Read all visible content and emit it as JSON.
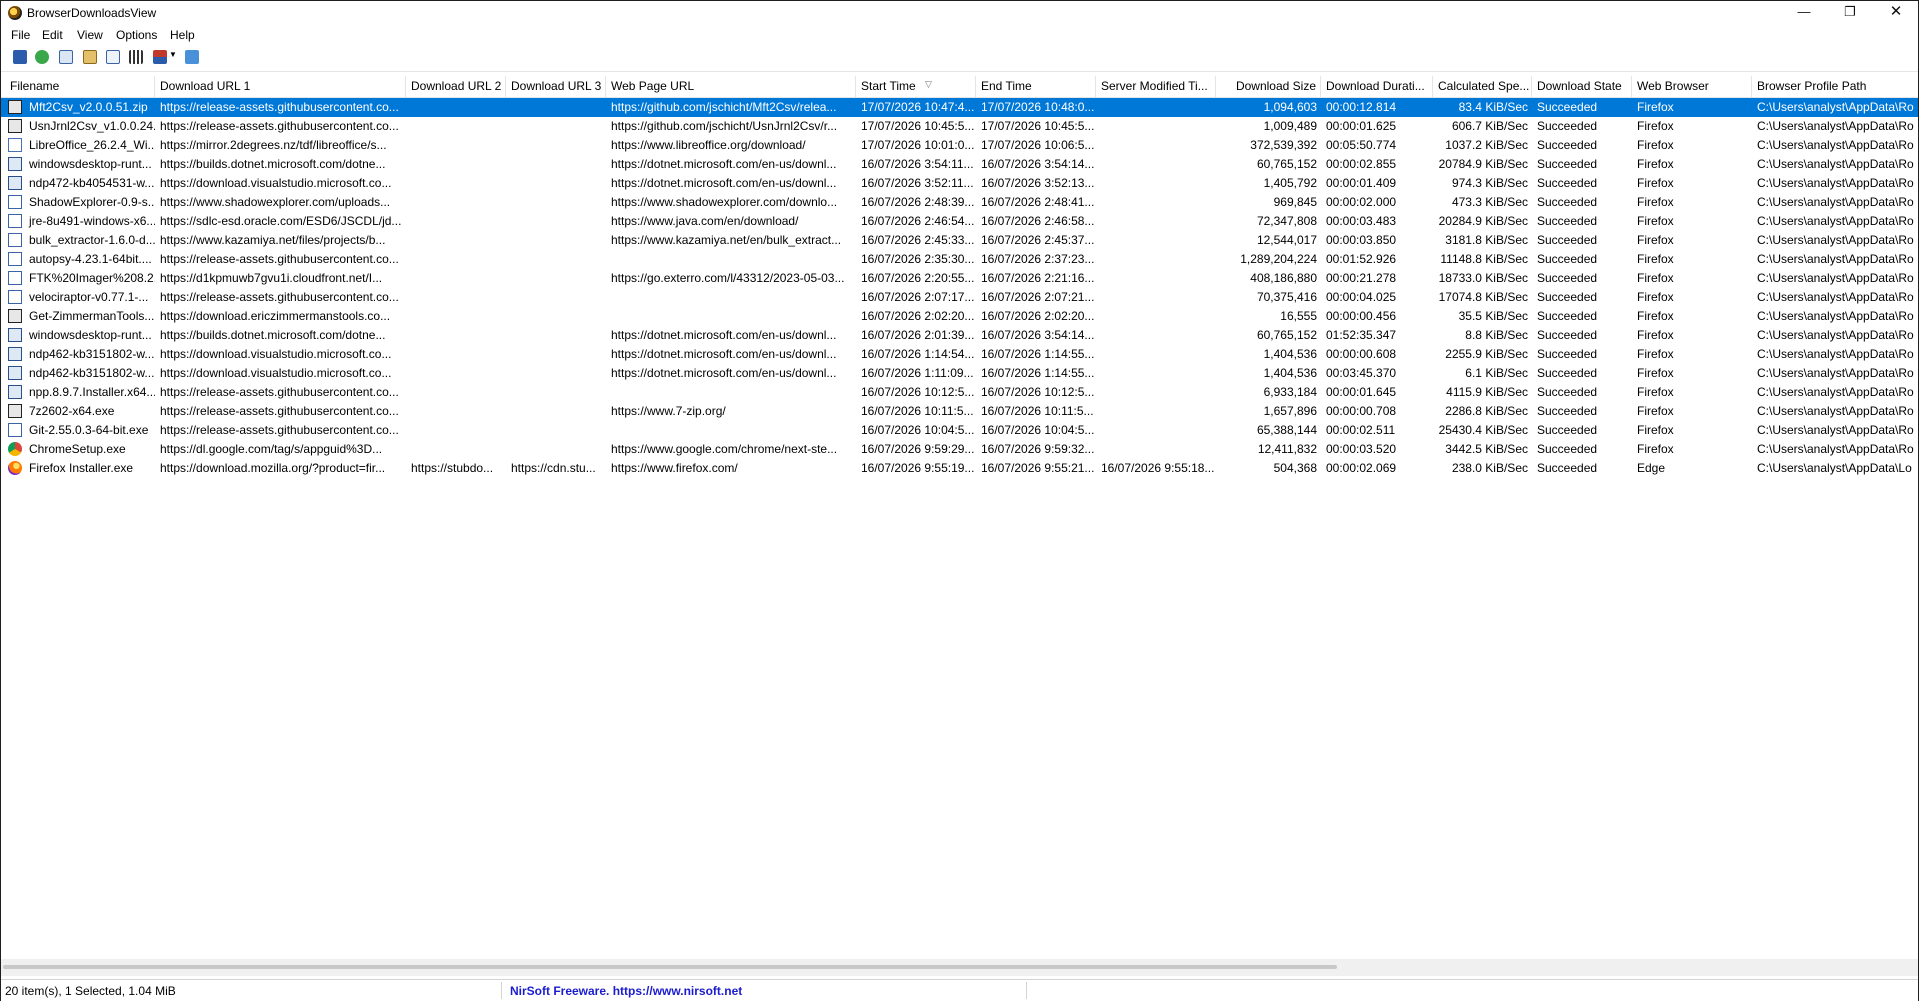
{
  "window": {
    "title": "BrowserDownloadsView",
    "minimize": "—",
    "maximize": "❐",
    "close": "✕"
  },
  "menu": [
    "File",
    "Edit",
    "View",
    "Options",
    "Help"
  ],
  "toolbar": [
    "save-icon",
    "refresh-icon",
    "copy-icon",
    "properties-icon",
    "find-icon",
    "html-report-icon",
    "sort-icon",
    "exit-icon"
  ],
  "columns": [
    "Filename",
    "Download URL 1",
    "Download URL 2",
    "Download URL 3",
    "Web Page URL",
    "Start Time",
    "End Time",
    "Server Modified Ti...",
    "Download Size",
    "Download Durati...",
    "Calculated Spe...",
    "Download State",
    "Web Browser",
    "Browser Profile Path"
  ],
  "rows": [
    {
      "icon": "zip",
      "selected": true,
      "c": [
        "Mft2Csv_v2.0.0.51.zip",
        "https://release-assets.githubusercontent.co...",
        "",
        "",
        "https://github.com/jschicht/Mft2Csv/relea...",
        "17/07/2026 10:47:4...",
        "17/07/2026 10:48:0...",
        "",
        "1,094,603",
        "00:00:12.814",
        "83.4 KiB/Sec",
        "Succeeded",
        "Firefox",
        "C:\\Users\\analyst\\AppData\\Ro"
      ]
    },
    {
      "icon": "zip",
      "c": [
        "UsnJrnl2Csv_v1.0.0.24....",
        "https://release-assets.githubusercontent.co...",
        "",
        "",
        "https://github.com/jschicht/UsnJrnl2Csv/r...",
        "17/07/2026 10:45:5...",
        "17/07/2026 10:45:5...",
        "",
        "1,009,489",
        "00:00:01.625",
        "606.7 KiB/Sec",
        "Succeeded",
        "Firefox",
        "C:\\Users\\analyst\\AppData\\Ro"
      ]
    },
    {
      "icon": "msi",
      "c": [
        "LibreOffice_26.2.4_Wi...",
        "https://mirror.2degrees.nz/tdf/libreoffice/s...",
        "",
        "",
        "https://www.libreoffice.org/download/",
        "17/07/2026 10:01:0...",
        "17/07/2026 10:06:5...",
        "",
        "372,539,392",
        "00:05:50.774",
        "1037.2 KiB/Sec",
        "Succeeded",
        "Firefox",
        "C:\\Users\\analyst\\AppData\\Ro"
      ]
    },
    {
      "icon": "setup",
      "c": [
        "windowsdesktop-runt...",
        "https://builds.dotnet.microsoft.com/dotne...",
        "",
        "",
        "https://dotnet.microsoft.com/en-us/downl...",
        "16/07/2026 3:54:11...",
        "16/07/2026 3:54:14...",
        "",
        "60,765,152",
        "00:00:02.855",
        "20784.9 KiB/Sec",
        "Succeeded",
        "Firefox",
        "C:\\Users\\analyst\\AppData\\Ro"
      ]
    },
    {
      "icon": "setup",
      "c": [
        "ndp472-kb4054531-w...",
        "https://download.visualstudio.microsoft.co...",
        "",
        "",
        "https://dotnet.microsoft.com/en-us/downl...",
        "16/07/2026 3:52:11...",
        "16/07/2026 3:52:13...",
        "",
        "1,405,792",
        "00:00:01.409",
        "974.3 KiB/Sec",
        "Succeeded",
        "Firefox",
        "C:\\Users\\analyst\\AppData\\Ro"
      ]
    },
    {
      "icon": "exe",
      "c": [
        "ShadowExplorer-0.9-s...",
        "https://www.shadowexplorer.com/uploads...",
        "",
        "",
        "https://www.shadowexplorer.com/downlo...",
        "16/07/2026 2:48:39...",
        "16/07/2026 2:48:41...",
        "",
        "969,845",
        "00:00:02.000",
        "473.3 KiB/Sec",
        "Succeeded",
        "Firefox",
        "C:\\Users\\analyst\\AppData\\Ro"
      ]
    },
    {
      "icon": "exe",
      "c": [
        "jre-8u491-windows-x6...",
        "https://sdlc-esd.oracle.com/ESD6/JSCDL/jd...",
        "",
        "",
        "https://www.java.com/en/download/",
        "16/07/2026 2:46:54...",
        "16/07/2026 2:46:58...",
        "",
        "72,347,808",
        "00:00:03.483",
        "20284.9 KiB/Sec",
        "Succeeded",
        "Firefox",
        "C:\\Users\\analyst\\AppData\\Ro"
      ]
    },
    {
      "icon": "exe",
      "c": [
        "bulk_extractor-1.6.0-d...",
        "https://www.kazamiya.net/files/projects/b...",
        "",
        "",
        "https://www.kazamiya.net/en/bulk_extract...",
        "16/07/2026 2:45:33...",
        "16/07/2026 2:45:37...",
        "",
        "12,544,017",
        "00:00:03.850",
        "3181.8 KiB/Sec",
        "Succeeded",
        "Firefox",
        "C:\\Users\\analyst\\AppData\\Ro"
      ]
    },
    {
      "icon": "exe",
      "c": [
        "autopsy-4.23.1-64bit....",
        "https://release-assets.githubusercontent.co...",
        "",
        "",
        "",
        "16/07/2026 2:35:30...",
        "16/07/2026 2:37:23...",
        "",
        "1,289,204,224",
        "00:01:52.926",
        "11148.8 KiB/Sec",
        "Succeeded",
        "Firefox",
        "C:\\Users\\analyst\\AppData\\Ro"
      ]
    },
    {
      "icon": "exe",
      "c": [
        "FTK%20Imager%208.2....",
        "https://d1kpmuwb7gvu1i.cloudfront.net/I...",
        "",
        "",
        "https://go.exterro.com/l/43312/2023-05-03...",
        "16/07/2026 2:20:55...",
        "16/07/2026 2:21:16...",
        "",
        "408,186,880",
        "00:00:21.278",
        "18733.0 KiB/Sec",
        "Succeeded",
        "Firefox",
        "C:\\Users\\analyst\\AppData\\Ro"
      ]
    },
    {
      "icon": "exe",
      "c": [
        "velociraptor-v0.77.1-...",
        "https://release-assets.githubusercontent.co...",
        "",
        "",
        "",
        "16/07/2026 2:07:17...",
        "16/07/2026 2:07:21...",
        "",
        "70,375,416",
        "00:00:04.025",
        "17074.8 KiB/Sec",
        "Succeeded",
        "Firefox",
        "C:\\Users\\analyst\\AppData\\Ro"
      ]
    },
    {
      "icon": "zip",
      "c": [
        "Get-ZimmermanTools....",
        "https://download.ericzimmermanstools.co...",
        "",
        "",
        "",
        "16/07/2026 2:02:20...",
        "16/07/2026 2:02:20...",
        "",
        "16,555",
        "00:00:00.456",
        "35.5 KiB/Sec",
        "Succeeded",
        "Firefox",
        "C:\\Users\\analyst\\AppData\\Ro"
      ]
    },
    {
      "icon": "setup",
      "c": [
        "windowsdesktop-runt...",
        "https://builds.dotnet.microsoft.com/dotne...",
        "",
        "",
        "https://dotnet.microsoft.com/en-us/downl...",
        "16/07/2026 2:01:39...",
        "16/07/2026 3:54:14...",
        "",
        "60,765,152",
        "01:52:35.347",
        "8.8 KiB/Sec",
        "Succeeded",
        "Firefox",
        "C:\\Users\\analyst\\AppData\\Ro"
      ]
    },
    {
      "icon": "setup",
      "c": [
        "ndp462-kb3151802-w...",
        "https://download.visualstudio.microsoft.co...",
        "",
        "",
        "https://dotnet.microsoft.com/en-us/downl...",
        "16/07/2026 1:14:54...",
        "16/07/2026 1:14:55...",
        "",
        "1,404,536",
        "00:00:00.608",
        "2255.9 KiB/Sec",
        "Succeeded",
        "Firefox",
        "C:\\Users\\analyst\\AppData\\Ro"
      ]
    },
    {
      "icon": "setup",
      "c": [
        "ndp462-kb3151802-w...",
        "https://download.visualstudio.microsoft.co...",
        "",
        "",
        "https://dotnet.microsoft.com/en-us/downl...",
        "16/07/2026 1:11:09...",
        "16/07/2026 1:14:55...",
        "",
        "1,404,536",
        "00:03:45.370",
        "6.1 KiB/Sec",
        "Succeeded",
        "Firefox",
        "C:\\Users\\analyst\\AppData\\Ro"
      ]
    },
    {
      "icon": "setup",
      "c": [
        "npp.8.9.7.Installer.x64....",
        "https://release-assets.githubusercontent.co...",
        "",
        "",
        "",
        "16/07/2026 10:12:5...",
        "16/07/2026 10:12:5...",
        "",
        "6,933,184",
        "00:00:01.645",
        "4115.9 KiB/Sec",
        "Succeeded",
        "Firefox",
        "C:\\Users\\analyst\\AppData\\Ro"
      ]
    },
    {
      "icon": "zip",
      "c": [
        "7z2602-x64.exe",
        "https://release-assets.githubusercontent.co...",
        "",
        "",
        "https://www.7-zip.org/",
        "16/07/2026 10:11:5...",
        "16/07/2026 10:11:5...",
        "",
        "1,657,896",
        "00:00:00.708",
        "2286.8 KiB/Sec",
        "Succeeded",
        "Firefox",
        "C:\\Users\\analyst\\AppData\\Ro"
      ]
    },
    {
      "icon": "exe",
      "c": [
        "Git-2.55.0.3-64-bit.exe",
        "https://release-assets.githubusercontent.co...",
        "",
        "",
        "",
        "16/07/2026 10:04:5...",
        "16/07/2026 10:04:5...",
        "",
        "65,388,144",
        "00:00:02.511",
        "25430.4 KiB/Sec",
        "Succeeded",
        "Firefox",
        "C:\\Users\\analyst\\AppData\\Ro"
      ]
    },
    {
      "icon": "chrome",
      "c": [
        "ChromeSetup.exe",
        "https://dl.google.com/tag/s/appguid%3D...",
        "",
        "",
        "https://www.google.com/chrome/next-ste...",
        "16/07/2026 9:59:29...",
        "16/07/2026 9:59:32...",
        "",
        "12,411,832",
        "00:00:03.520",
        "3442.5 KiB/Sec",
        "Succeeded",
        "Firefox",
        "C:\\Users\\analyst\\AppData\\Ro"
      ]
    },
    {
      "icon": "fox",
      "c": [
        "Firefox Installer.exe",
        "https://download.mozilla.org/?product=fir...",
        "https://stubdo...",
        "https://cdn.stu...",
        "https://www.firefox.com/",
        "16/07/2026 9:55:19...",
        "16/07/2026 9:55:21...",
        "16/07/2026 9:55:18...",
        "504,368",
        "00:00:02.069",
        "238.0 KiB/Sec",
        "Succeeded",
        "Edge",
        "C:\\Users\\analyst\\AppData\\Lo"
      ]
    }
  ],
  "status": {
    "items": "20 item(s), 1 Selected, 1.04 MiB",
    "link": "NirSoft Freeware. https://www.nirsoft.net"
  },
  "colors": {
    "selection": "#0078d7",
    "link": "#1b1bd0"
  }
}
